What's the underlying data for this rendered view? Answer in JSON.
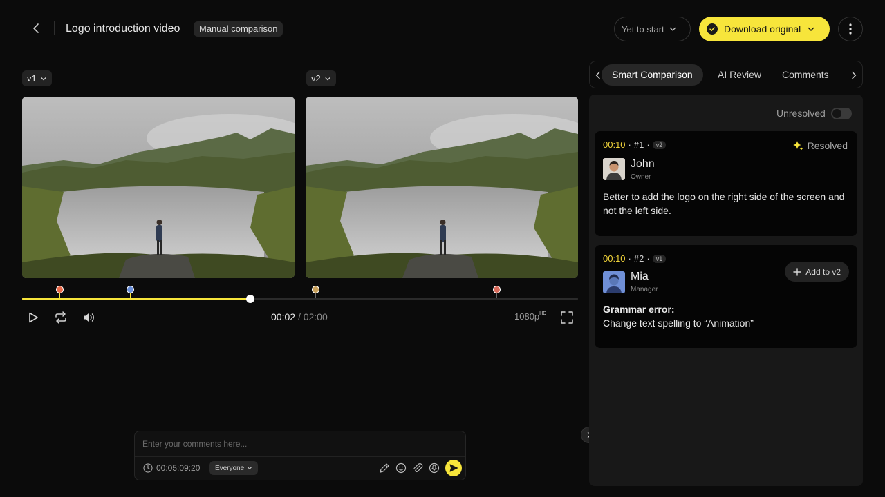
{
  "header": {
    "title": "Logo introduction video",
    "mode_badge": "Manual comparison",
    "status_label": "Yet to start",
    "download_label": "Download original"
  },
  "viewer": {
    "left_version": "v1",
    "right_version": "v2",
    "current_time": "00:02",
    "separator": "/",
    "duration": "02:00",
    "progress_fraction": 0.41,
    "quality": "1080p",
    "quality_badge": "HD",
    "markers": [
      {
        "fraction": 0.067,
        "color": "#e86a4a",
        "line": "#f7e53b"
      },
      {
        "fraction": 0.194,
        "color": "#6a8fd8",
        "line": "#f7e53b"
      },
      {
        "fraction": 0.527,
        "color": "#c8a05a",
        "line": "#666666"
      },
      {
        "fraction": 0.853,
        "color": "#d86a5a",
        "line": "#666666"
      }
    ]
  },
  "composer": {
    "placeholder": "Enter your comments here...",
    "timestamp": "00:05:09:20",
    "audience": "Everyone"
  },
  "panel": {
    "tabs": [
      {
        "label": "Smart Comparison",
        "active": true
      },
      {
        "label": "AI Review",
        "active": false
      },
      {
        "label": "Comments",
        "active": false
      }
    ],
    "filter_label": "Unresolved",
    "comments": [
      {
        "time": "00:10",
        "number": "#1",
        "version": "v2",
        "author": "John",
        "role": "Owner",
        "status": "Resolved",
        "text": "Better to add the logo on the right side of the screen and not the left side."
      },
      {
        "time": "00:10",
        "number": "#2",
        "version": "v1",
        "author": "Mia",
        "role": "Manager",
        "action": "Add to v2",
        "heading": "Grammar error:",
        "text": "Change text spelling to “Animation”"
      }
    ]
  },
  "colors": {
    "accent": "#f7e53b",
    "timestamp": "#f0d33a",
    "background": "#0b0b0b",
    "panel": "#181818"
  }
}
